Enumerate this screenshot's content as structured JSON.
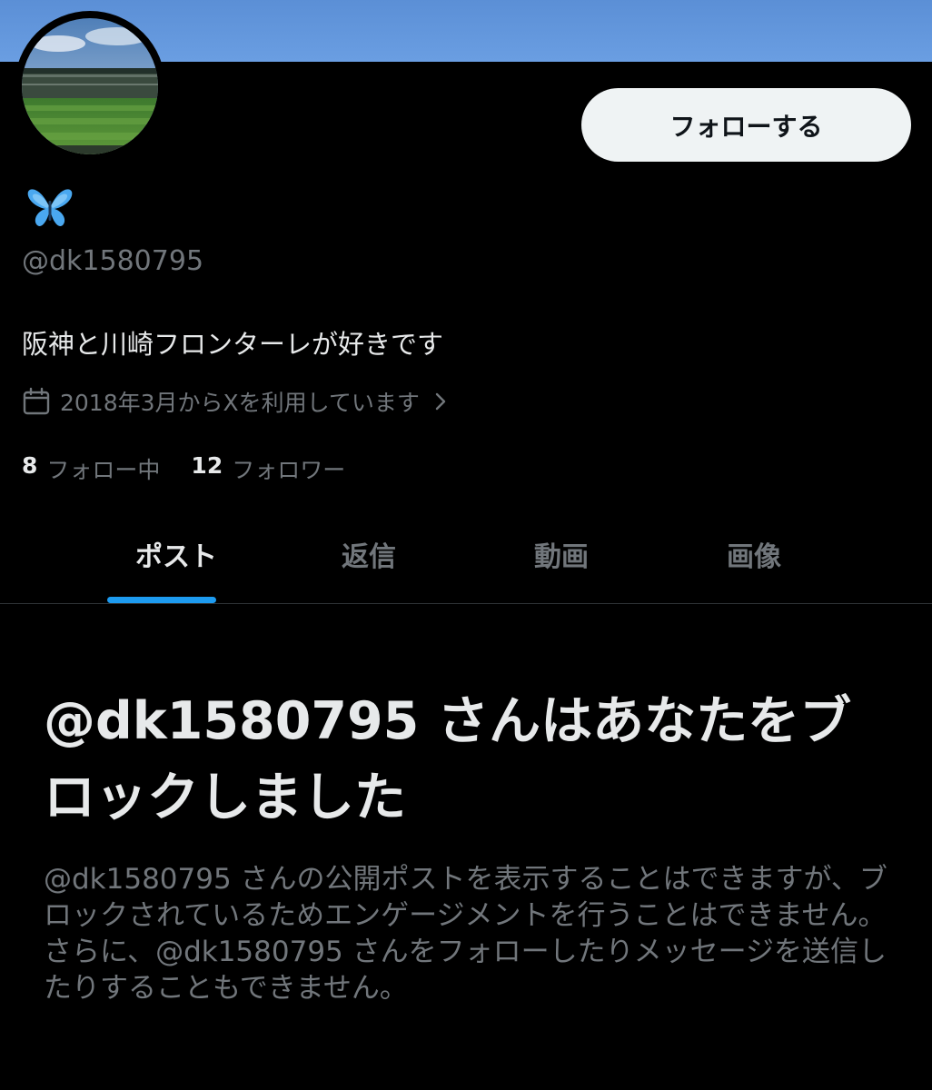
{
  "profile": {
    "handle": "@dk1580795",
    "bio": "阪神と川崎フロンターレが好きです",
    "joined": "2018年3月からXを利用しています",
    "following_count": "8",
    "following_label": "フォロー中",
    "followers_count": "12",
    "followers_label": "フォロワー"
  },
  "actions": {
    "follow_label": "フォローする"
  },
  "tabs": [
    {
      "label": "ポスト",
      "active": true
    },
    {
      "label": "返信",
      "active": false
    },
    {
      "label": "動画",
      "active": false
    },
    {
      "label": "画像",
      "active": false
    }
  ],
  "blocked": {
    "title": "@dk1580795 さんはあなたをブロックしました",
    "body": "@dk1580795 さんの公開ポストを表示することはできますが、ブロックされているためエンゲージメントを行うことはできません。さらに、@dk1580795 さんをフォローしたりメッセージを送信したりすることもできません。"
  },
  "colors": {
    "background": "#000000",
    "accent": "#1d9bf0",
    "banner": "#6a9ee2",
    "muted_text": "#71767b",
    "primary_text": "#e7e9ea",
    "button_bg": "#eff3f4"
  },
  "icons": {
    "display_name": "butterfly-emoji",
    "joined": "calendar-icon",
    "joined_more": "chevron-right-icon"
  }
}
